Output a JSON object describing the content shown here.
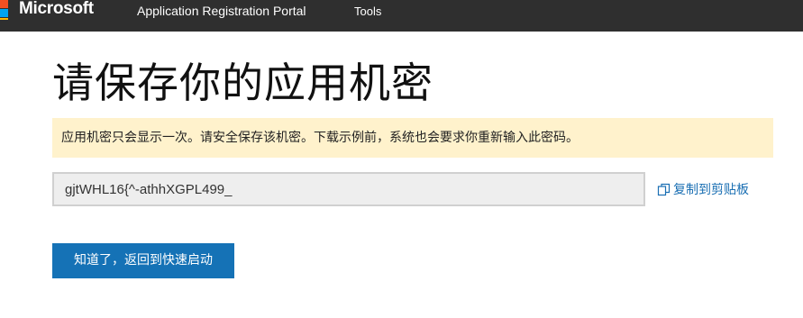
{
  "header": {
    "brand": "Microsoft",
    "nav": [
      {
        "label": "Application Registration Portal"
      },
      {
        "label": "Tools"
      }
    ]
  },
  "page": {
    "title": "请保存你的应用机密",
    "notice": "应用机密只会显示一次。请安全保存该机密。下载示例前，系统也会要求你重新输入此密码。",
    "secret_value": "gjtWHL16{^-athhXGPL499_",
    "copy_label": "复制到剪贴板",
    "confirm_button": "知道了，返回到快速启动"
  },
  "icons": {
    "logo": "microsoft-logo-icon",
    "copy": "copy-icon"
  },
  "colors": {
    "topbar": "#2f2f2f",
    "notice_bg": "#fff2cc",
    "link": "#1a6fb3",
    "button": "#1572b6"
  }
}
